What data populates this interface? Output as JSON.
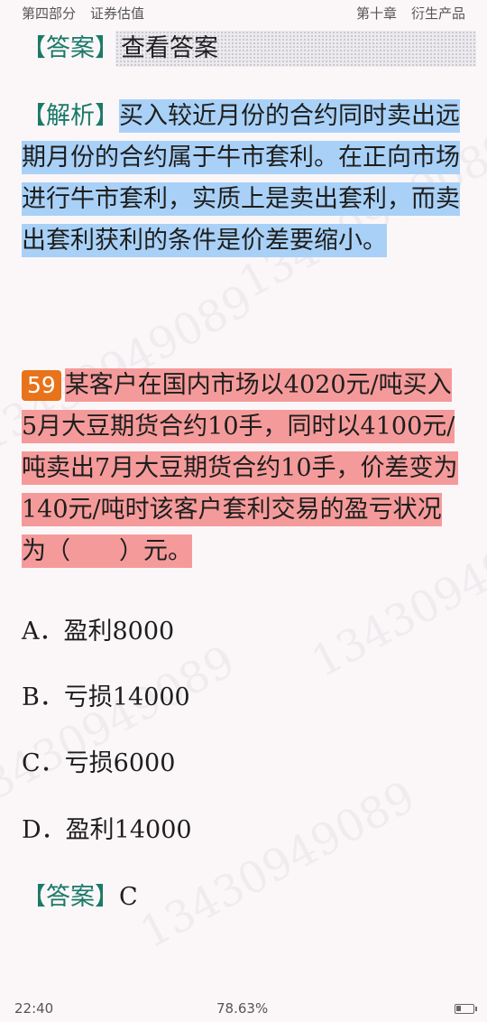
{
  "header": {
    "part": "第四部分",
    "section": "证券估值",
    "chapter": "第十章",
    "chapter_title": "衍生产品"
  },
  "answer_reveal": {
    "bracket": "【答案】",
    "button_label": "查看答案"
  },
  "analysis": {
    "bracket": "【解析】",
    "text": "买入较近月份的合约同时卖出远期月份的合约属于牛市套利。在正向市场进行牛市套利，实质上是卖出套利，而卖出套利获利的条件是价差要缩小。"
  },
  "question": {
    "number": "59",
    "text": "某客户在国内市场以4020元/吨买入5月大豆期货合约10手，同时以4100元/吨卖出7月大豆期货合约10手，价差变为140元/吨时该客户套利交易的盈亏状况为（　　）元。"
  },
  "options": [
    {
      "letter": "A",
      "text": "盈利8000"
    },
    {
      "letter": "B",
      "text": "亏损14000"
    },
    {
      "letter": "C",
      "text": "亏损6000"
    },
    {
      "letter": "D",
      "text": "盈利14000"
    }
  ],
  "answer": {
    "bracket": "【答案】",
    "value": "C"
  },
  "watermark": "13430949089",
  "footer": {
    "time": "22:40",
    "progress": "78.63%",
    "battery_level": 0.3
  },
  "colors": {
    "highlight_blue": "#a9d1f7",
    "highlight_red": "#f59a9a",
    "question_badge": "#e8731a",
    "bracket_green": "#1a7a68"
  }
}
